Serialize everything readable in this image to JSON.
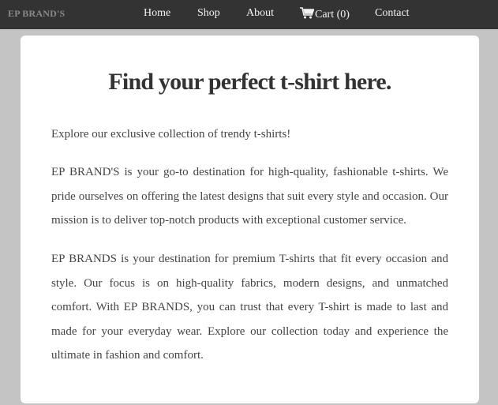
{
  "navbar": {
    "brand": "EP BRAND'S",
    "links": [
      {
        "label": "Home"
      },
      {
        "label": "Shop"
      },
      {
        "label": "About"
      },
      {
        "label": "Cart (0)",
        "icon": "shopping-cart-icon"
      },
      {
        "label": "Contact"
      }
    ]
  },
  "main": {
    "title": "Find your perfect t-shirt here.",
    "intro": "Explore our exclusive collection of trendy t-shirts!",
    "about": "EP BRAND'S is your go-to destination for high-quality, fashionable t-shirts. We pride ourselves on offering the latest designs that suit every style and occasion. Our mission is to deliver top-notch products with exceptional customer service.",
    "mission": "EP BRANDS is your destination for premium T-shirts that fit every occasion and style. Our focus is on high-quality fabrics, modern designs, and unmatched comfort. With EP BRANDS, you can trust that every T-shirt is made to last and made for your everyday wear. Explore our collection today and experience the ultimate in fashion and comfort."
  },
  "colors": {
    "navbar_bg": "#333333",
    "page_bg": "#c4c4c4",
    "card_bg": "#ffffff",
    "text": "#444444"
  }
}
